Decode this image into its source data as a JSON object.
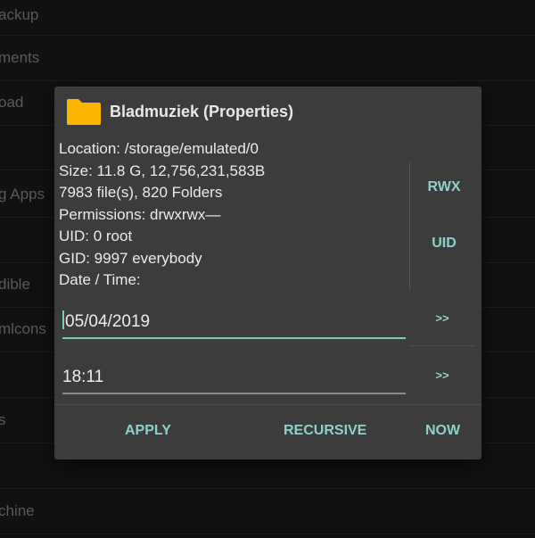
{
  "background": {
    "items": [
      {
        "label": "ackup"
      },
      {
        "label": "ments"
      },
      {
        "label": "oad"
      },
      {
        "label": ""
      },
      {
        "label": "g Apps"
      },
      {
        "label": ""
      },
      {
        "label": "dible"
      },
      {
        "label": "mlcons"
      },
      {
        "label": ""
      },
      {
        "label": "s"
      },
      {
        "label": ""
      },
      {
        "label": "chine"
      }
    ]
  },
  "dialog": {
    "title": "Bladmuziek (Properties)",
    "folder_icon": "folder-icon",
    "info": {
      "location": "Location: /storage/emulated/0",
      "size": "Size: 11.8 G, 12,756,231,583B",
      "counts": "7983 file(s), 820 Folders",
      "permissions": "Permissions: drwxrwx—",
      "uid": "UID: 0 root",
      "gid": "GID: 9997 everybody",
      "datetime": "Date / Time:"
    },
    "side_buttons": {
      "rwx": "RWX",
      "uid": "UID"
    },
    "date_field": {
      "value": "05/04/2019"
    },
    "time_field": {
      "value": "18:11"
    },
    "date_arrow": ">>",
    "time_arrow": ">>",
    "actions": {
      "apply": "APPLY",
      "recursive": "RECURSIVE",
      "now": "NOW"
    }
  },
  "colors": {
    "accent": "#8ed1c9",
    "folder": "#fbb500",
    "dialog_bg": "#3c3c3c",
    "screen_bg": "#111111"
  }
}
